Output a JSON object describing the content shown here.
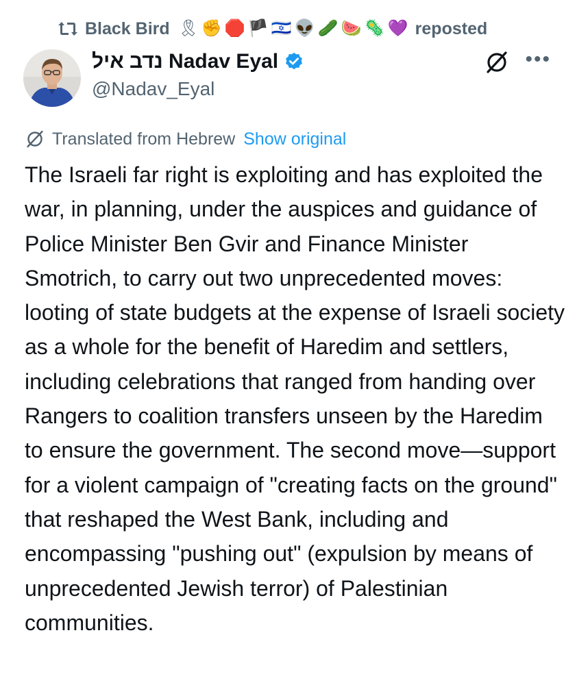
{
  "repost": {
    "icon": "repost-icon",
    "user": "Black Bird",
    "emojis": [
      "🎗",
      "✊",
      "🛑",
      "🏴",
      "🇮🇱",
      "👽",
      "🥒",
      "🍉",
      "🦠",
      "💜"
    ],
    "label": "reposted"
  },
  "author": {
    "avatar": "avatar-photo",
    "display_name": "נדב איל Nadav Eyal",
    "verified_icon": "verified-badge-icon",
    "handle": "@Nadav_Eyal",
    "verified_color": "#1d9bf0"
  },
  "header_actions": {
    "translate_icon": "translate-icon",
    "more_label": "•••"
  },
  "translation": {
    "icon": "translate-icon",
    "text": "Translated from Hebrew",
    "link": "Show original",
    "link_color": "#1d9bf0"
  },
  "tweet": {
    "text": "The Israeli far right is exploiting and has exploited the war, in planning, under the auspices and guidance of Police Minister Ben Gvir and Finance Minister Smotrich, to carry out two unprecedented moves: looting of state budgets at the expense of Israeli society as a whole for the benefit of Haredim and settlers, including celebrations that ranged from handing over Rangers to coalition transfers unseen by the Haredim to ensure the government. The second move—support for a violent campaign of \"creating facts on the ground\" that reshaped the West Bank, including and encompassing \"pushing out\" (expulsion by means of unprecedented Jewish terror) of Palestinian communities."
  }
}
